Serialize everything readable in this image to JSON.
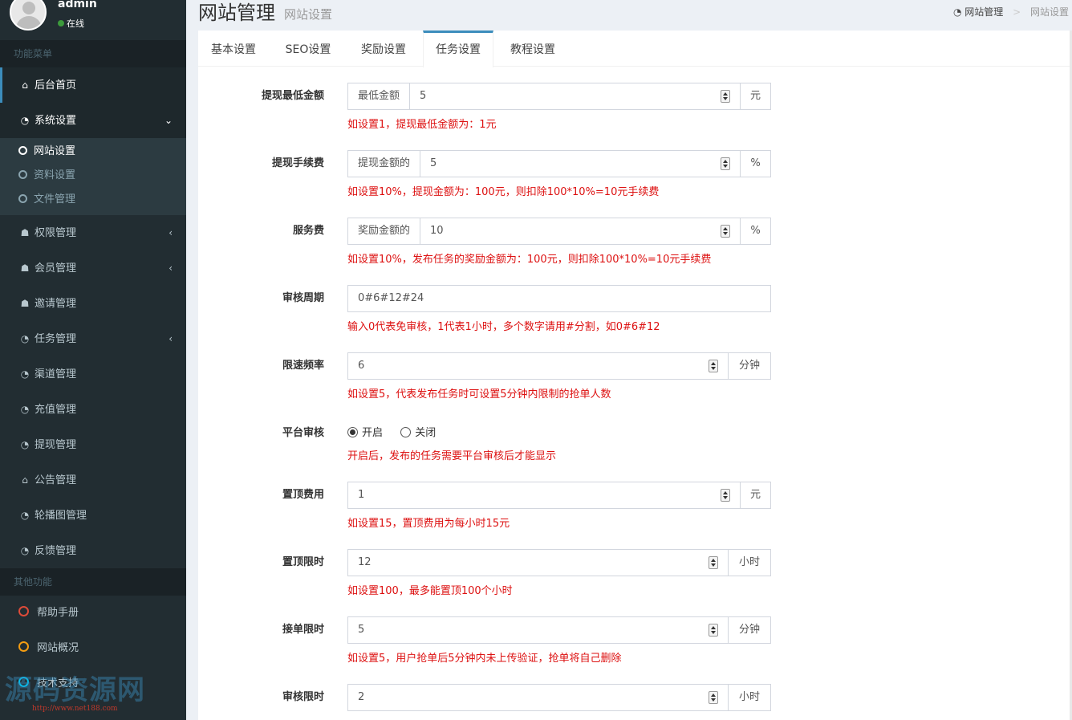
{
  "user": {
    "name": "admin",
    "status": "在线"
  },
  "sidebar": {
    "header_main": "功能菜单",
    "items": [
      {
        "label": "后台首页",
        "icon": "home-icon",
        "glyph": "⌂"
      },
      {
        "label": "系统设置",
        "icon": "dashboard-icon",
        "glyph": "◔",
        "arrow": "⌄"
      },
      {
        "label": "权限管理",
        "icon": "users-icon",
        "glyph": "☗",
        "arrow": "‹"
      },
      {
        "label": "会员管理",
        "icon": "users-icon",
        "glyph": "☗",
        "arrow": "‹"
      },
      {
        "label": "邀请管理",
        "icon": "users-icon",
        "glyph": "☗"
      },
      {
        "label": "任务管理",
        "icon": "dashboard-icon",
        "glyph": "◔",
        "arrow": "‹"
      },
      {
        "label": "渠道管理",
        "icon": "dashboard-icon",
        "glyph": "◔"
      },
      {
        "label": "充值管理",
        "icon": "dashboard-icon",
        "glyph": "◔"
      },
      {
        "label": "提现管理",
        "icon": "dashboard-icon",
        "glyph": "◔"
      },
      {
        "label": "公告管理",
        "icon": "home-icon",
        "glyph": "⌂"
      },
      {
        "label": "轮播图管理",
        "icon": "dashboard-icon",
        "glyph": "◔"
      },
      {
        "label": "反馈管理",
        "icon": "dashboard-icon",
        "glyph": "◔"
      }
    ],
    "submenu": [
      "网站设置",
      "资料设置",
      "文件管理"
    ],
    "header_other": "其他功能",
    "other_items": [
      {
        "label": "帮助手册",
        "color": "#dd4b39"
      },
      {
        "label": "网站概况",
        "color": "#f39c12"
      },
      {
        "label": "技术支持",
        "color": "#00c0ef"
      }
    ],
    "watermark": "源码资源网",
    "watermark_url": "http://www.net188.com"
  },
  "header": {
    "title": "网站管理",
    "subtitle": "网站设置",
    "breadcrumb_home": "网站管理",
    "breadcrumb_sep": ">",
    "breadcrumb_current": "网站设置",
    "home_glyph": "◔"
  },
  "tabs": [
    "基本设置",
    "SEO设置",
    "奖励设置",
    "任务设置",
    "教程设置"
  ],
  "form": {
    "f1": {
      "label": "提现最低金额",
      "prefix": "最低金额",
      "value": "5",
      "suffix": "元",
      "help": "如设置1，提现最低金额为：1元"
    },
    "f2": {
      "label": "提现手续费",
      "prefix": "提现金额的",
      "value": "5",
      "suffix": "%",
      "help": "如设置10%，提现金额为：100元，则扣除100*10%=10元手续费"
    },
    "f3": {
      "label": "服务费",
      "prefix": "奖励金额的",
      "value": "10",
      "suffix": "%",
      "help": "如设置10%，发布任务的奖励金额为：100元，则扣除100*10%=10元手续费"
    },
    "f4": {
      "label": "审核周期",
      "value": "0#6#12#24",
      "help": "输入0代表免审核，1代表1小时，多个数字请用#分割，如0#6#12"
    },
    "f5": {
      "label": "限速频率",
      "value": "6",
      "suffix": "分钟",
      "help": "如设置5，代表发布任务时可设置5分钟内限制的抢单人数"
    },
    "f6": {
      "label": "平台审核",
      "option_on": "开启",
      "option_off": "关闭",
      "selected": "开启",
      "help": "开启后，发布的任务需要平台审核后才能显示"
    },
    "f7": {
      "label": "置顶费用",
      "value": "1",
      "suffix": "元",
      "help": "如设置15，置顶费用为每小时15元"
    },
    "f8": {
      "label": "置顶限时",
      "value": "12",
      "suffix": "小时",
      "help": "如设置100，最多能置顶100个小时"
    },
    "f9": {
      "label": "接单限时",
      "value": "5",
      "suffix": "分钟",
      "help": "如设置5，用户抢单后5分钟内未上传验证，抢单将自己删除"
    },
    "f10": {
      "label": "审核限时",
      "value": "2",
      "suffix": "小时"
    }
  }
}
